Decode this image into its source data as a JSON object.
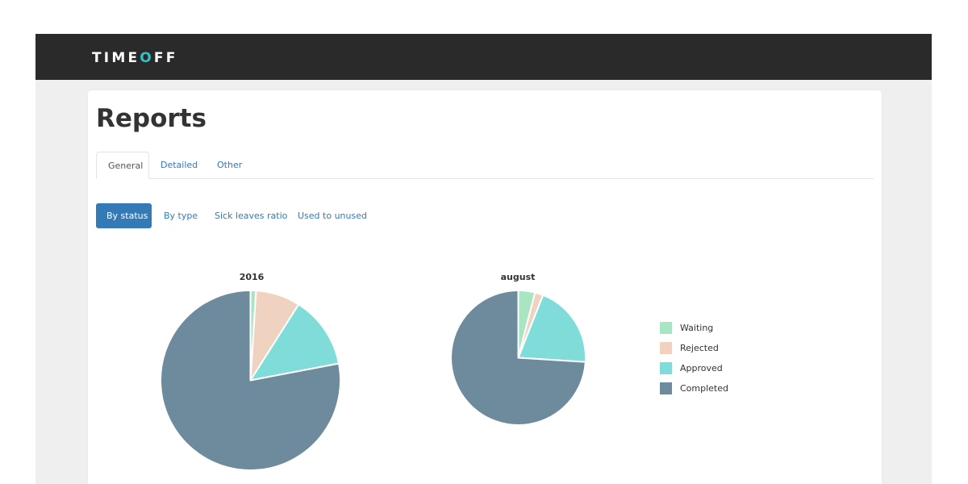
{
  "app": {
    "logo_part1": "TIME",
    "logo_accent": "O",
    "logo_part2": "FF",
    "accent_color": "#2ec4c6"
  },
  "page": {
    "title": "Reports"
  },
  "tabs": [
    {
      "label": "General",
      "active": true
    },
    {
      "label": "Detailed",
      "active": false
    },
    {
      "label": "Other",
      "active": false
    }
  ],
  "report_buttons": [
    {
      "label": "By status",
      "active": true
    },
    {
      "label": "By type",
      "active": false
    },
    {
      "label": "Sick leaves ratio",
      "active": false
    },
    {
      "label": "Used to unused",
      "active": false
    }
  ],
  "legend": [
    {
      "label": "Waiting",
      "color": "#a8e6c3"
    },
    {
      "label": "Rejected",
      "color": "#efd3c0"
    },
    {
      "label": "Approved",
      "color": "#7fdcd8"
    },
    {
      "label": "Completed",
      "color": "#6d8b9c"
    }
  ],
  "chart_data": [
    {
      "type": "pie",
      "title": "2016",
      "categories": [
        "Waiting",
        "Rejected",
        "Approved",
        "Completed"
      ],
      "values": [
        1,
        8,
        13,
        78
      ]
    },
    {
      "type": "pie",
      "title": "august",
      "categories": [
        "Waiting",
        "Rejected",
        "Approved",
        "Completed"
      ],
      "values": [
        4,
        2,
        20,
        74
      ]
    }
  ]
}
